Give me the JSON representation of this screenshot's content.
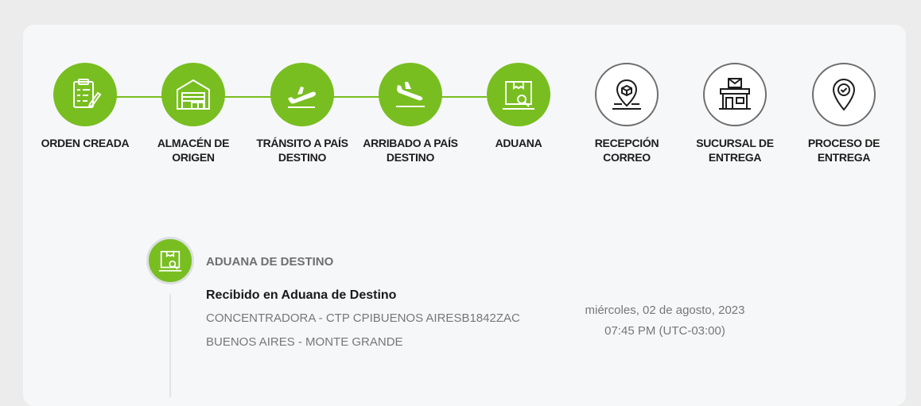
{
  "colors": {
    "done": "#78be20",
    "pending_border": "#6e6e6e",
    "text_dark": "#1d1d1d",
    "text_muted": "#777777"
  },
  "steps": [
    {
      "label": "ORDEN CREADA",
      "icon": "clipboard-icon",
      "status": "done"
    },
    {
      "label": "ALMACÉN DE ORIGEN",
      "icon": "warehouse-icon",
      "status": "done"
    },
    {
      "label": "TRÁNSITO A PAÍS DESTINO",
      "icon": "plane-takeoff-icon",
      "status": "done"
    },
    {
      "label": "ARRIBADO A PAÍS DESTINO",
      "icon": "plane-landing-icon",
      "status": "done"
    },
    {
      "label": "ADUANA",
      "icon": "customs-box-icon",
      "status": "done"
    },
    {
      "label": "RECEPCIÓN CORREO",
      "icon": "map-pin-box-icon",
      "status": "pending"
    },
    {
      "label": "SUCURSAL DE ENTREGA",
      "icon": "store-icon",
      "status": "pending"
    },
    {
      "label": "PROCESO DE ENTREGA",
      "icon": "location-check-icon",
      "status": "pending"
    }
  ],
  "event": {
    "icon": "customs-box-icon",
    "title": "ADUANA DE DESTINO",
    "headline": "Recibido en Aduana de Destino",
    "line1": "CONCENTRADORA - CTP CPIBUENOS AIRESB1842ZAC",
    "line2": "BUENOS AIRES - MONTE GRANDE",
    "date": "miércoles, 02 de agosto, 2023",
    "time": "07:45 PM (UTC-03:00)"
  }
}
